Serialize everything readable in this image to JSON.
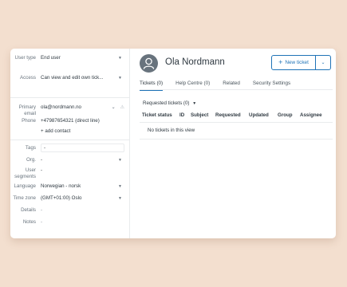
{
  "user_fields": {
    "user_type": {
      "label": "User type",
      "value": "End user"
    },
    "access": {
      "label": "Access",
      "value": "Can view and edit own tick..."
    },
    "primary_email": {
      "label": "Primary email",
      "value": "ola@nordmann.no"
    },
    "phone": {
      "label": "Phone",
      "value": "+47987654321 (direct line)"
    },
    "add_contact": "+ add contact",
    "tags": {
      "label": "Tags",
      "value": "-"
    },
    "org": {
      "label": "Org.",
      "value": "-"
    },
    "user_segments": {
      "label": "User segments",
      "value": "-"
    },
    "language": {
      "label": "Language",
      "value": "Norwegian - norsk"
    },
    "time_zone": {
      "label": "Time zone",
      "value": "(GMT+01:00) Oslo"
    },
    "details": {
      "label": "Details",
      "value": "-"
    },
    "notes": {
      "label": "Notes",
      "value": "-"
    }
  },
  "profile": {
    "name": "Ola Nordmann",
    "new_ticket_label": "New ticket"
  },
  "tabs": [
    {
      "label": "Tickets (0)",
      "active": true
    },
    {
      "label": "Help Centre (0)",
      "active": false
    },
    {
      "label": "Related",
      "active": false
    },
    {
      "label": "Security Settings",
      "active": false
    }
  ],
  "requested": {
    "title": "Requested tickets (0)",
    "columns": [
      "Ticket status",
      "ID",
      "Subject",
      "Requested",
      "Updated",
      "Group",
      "Assignee"
    ],
    "empty_text": "No tickets in this view"
  },
  "icons": {
    "avatar": "user-avatar-icon",
    "plus": "plus-icon",
    "chevron": "chevron-down-icon",
    "lock": "lock-icon"
  },
  "colors": {
    "background": "#f3dfcf",
    "accent": "#1f73b7",
    "avatar": "#68737d"
  }
}
